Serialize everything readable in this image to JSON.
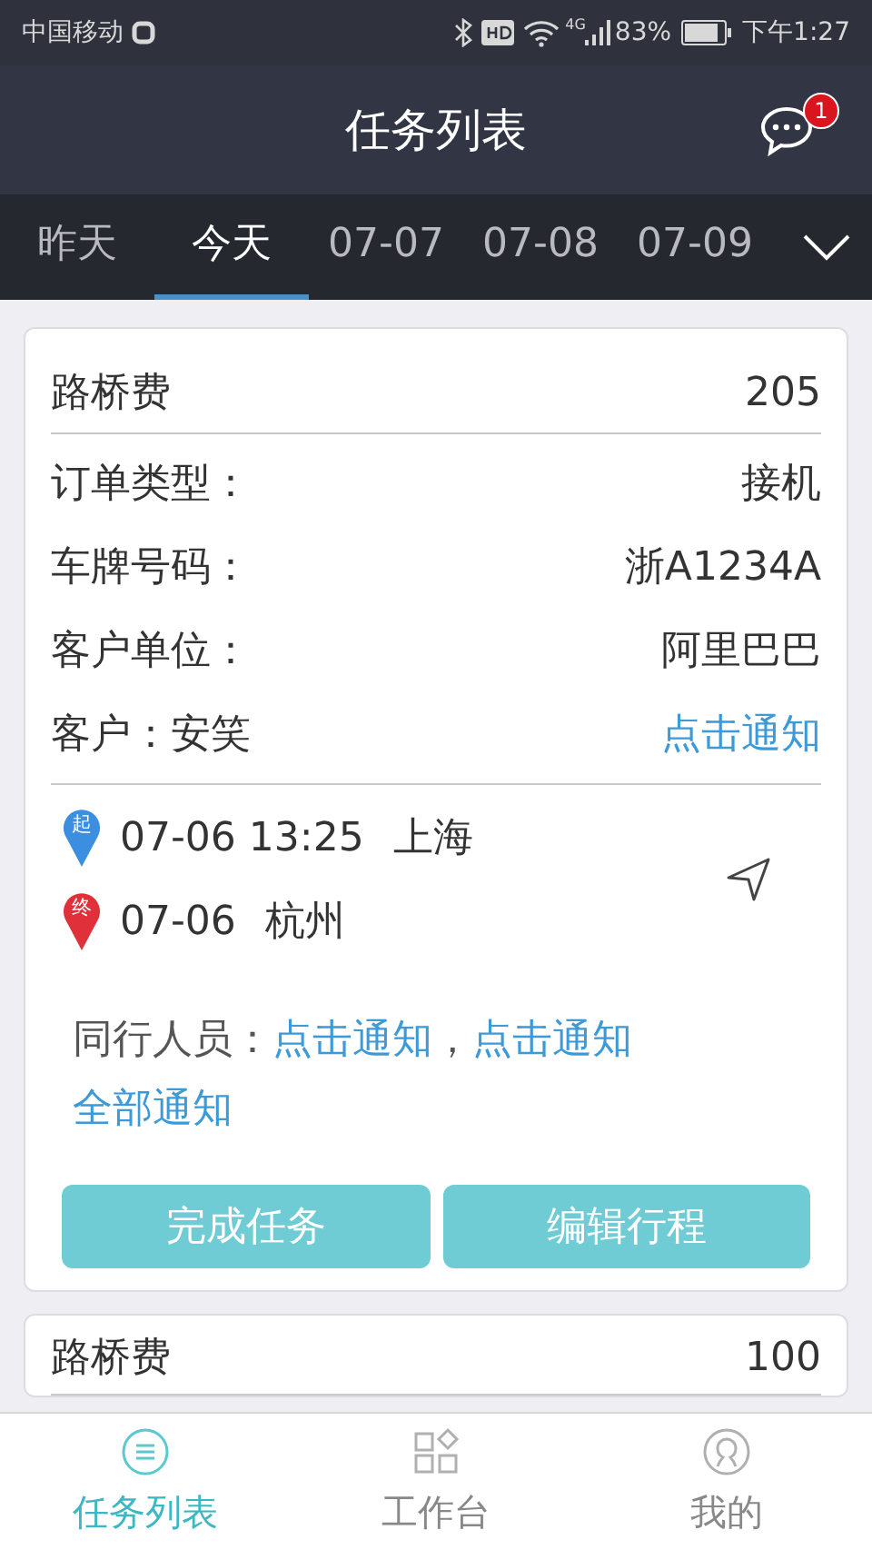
{
  "status_bar": {
    "carrier": "中国移动",
    "network": "4G",
    "battery": "83%",
    "time": "下午1:27"
  },
  "header": {
    "title": "任务列表",
    "badge": "1"
  },
  "date_tabs": [
    {
      "label": "昨天",
      "selected": false
    },
    {
      "label": "今天",
      "selected": true
    },
    {
      "label": "07-07",
      "selected": false
    },
    {
      "label": "07-08",
      "selected": false
    },
    {
      "label": "07-09",
      "selected": false
    }
  ],
  "tasks": [
    {
      "fee_label": "路桥费",
      "fee": "205",
      "fields": [
        {
          "label": "订单类型：",
          "value": "接机",
          "kind": "text"
        },
        {
          "label": "车牌号码：",
          "value": "浙A1234A",
          "kind": "text"
        },
        {
          "label": "客户单位：",
          "value": "阿里巴巴",
          "kind": "text"
        },
        {
          "label": "客户：安笑",
          "value": "点击通知",
          "kind": "link"
        }
      ],
      "stops": [
        {
          "marker": "起",
          "color": "#3b8ee0",
          "time": "07-06 13:25",
          "place": "上海"
        },
        {
          "marker": "终",
          "color": "#e0303a",
          "time": "07-06",
          "place": "杭州"
        }
      ],
      "companions": {
        "label": "同行人员：",
        "links": [
          "点击通知",
          "点击通知"
        ],
        "separator": "，",
        "all_link": "全部通知"
      },
      "buttons": [
        "完成任务",
        "编辑行程"
      ]
    },
    {
      "fee_label": "路桥费",
      "fee": "100"
    }
  ],
  "bottom_nav": [
    {
      "label": "任务列表",
      "kind": "list",
      "selected": true
    },
    {
      "label": "工作台",
      "kind": "grid",
      "selected": false
    },
    {
      "label": "我的",
      "kind": "user",
      "selected": false
    }
  ]
}
